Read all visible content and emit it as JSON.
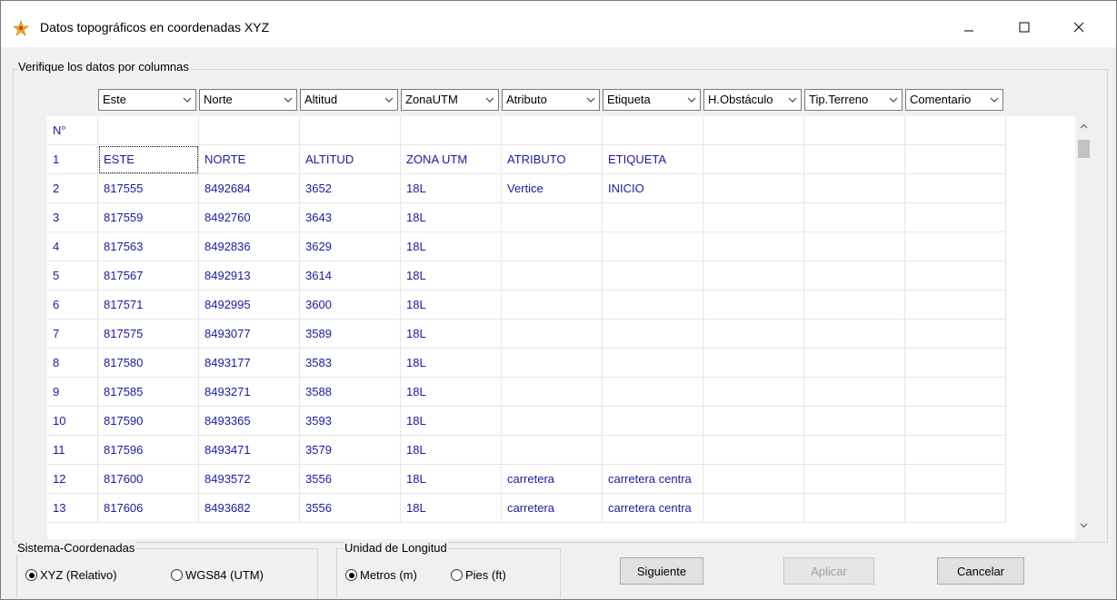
{
  "window": {
    "title": "Datos topográficos en coordenadas XYZ"
  },
  "group_main": {
    "label": "Verifique los datos por columnas"
  },
  "column_selectors": [
    "Este",
    "Norte",
    "Altitud",
    "ZonaUTM",
    "Atributo",
    "Etiqueta",
    "H.Obstáculo",
    "Tip.Terreno",
    "Comentario"
  ],
  "grid": {
    "rows": [
      [
        "N°",
        "",
        "",
        "",
        "",
        "",
        "",
        "",
        "",
        ""
      ],
      [
        "1",
        "ESTE",
        "NORTE",
        "ALTITUD",
        "ZONA UTM",
        "ATRIBUTO",
        "ETIQUETA",
        "",
        "",
        ""
      ],
      [
        "2",
        "817555",
        "8492684",
        "3652",
        "18L",
        "Vertice",
        "INICIO",
        "",
        "",
        ""
      ],
      [
        "3",
        "817559",
        "8492760",
        "3643",
        "18L",
        "",
        "",
        "",
        "",
        ""
      ],
      [
        "4",
        "817563",
        "8492836",
        "3629",
        "18L",
        "",
        "",
        "",
        "",
        ""
      ],
      [
        "5",
        "817567",
        "8492913",
        "3614",
        "18L",
        "",
        "",
        "",
        "",
        ""
      ],
      [
        "6",
        "817571",
        "8492995",
        "3600",
        "18L",
        "",
        "",
        "",
        "",
        ""
      ],
      [
        "7",
        "817575",
        "8493077",
        "3589",
        "18L",
        "",
        "",
        "",
        "",
        ""
      ],
      [
        "8",
        "817580",
        "8493177",
        "3583",
        "18L",
        "",
        "",
        "",
        "",
        ""
      ],
      [
        "9",
        "817585",
        "8493271",
        "3588",
        "18L",
        "",
        "",
        "",
        "",
        ""
      ],
      [
        "10",
        "817590",
        "8493365",
        "3593",
        "18L",
        "",
        "",
        "",
        "",
        ""
      ],
      [
        "11",
        "817596",
        "8493471",
        "3579",
        "18L",
        "",
        "",
        "",
        "",
        ""
      ],
      [
        "12",
        "817600",
        "8493572",
        "3556",
        "18L",
        "carretera",
        "carretera centra",
        "",
        "",
        ""
      ],
      [
        "13",
        "817606",
        "8493682",
        "3556",
        "18L",
        "carretera",
        "carretera centra",
        "",
        "",
        ""
      ]
    ]
  },
  "sistema": {
    "label": "Sistema-Coordenadas",
    "options": [
      "XYZ (Relativo)",
      "WGS84 (UTM)"
    ],
    "selected": "XYZ (Relativo)"
  },
  "unidad": {
    "label": "Unidad de Longitud",
    "options": [
      "Metros (m)",
      "Pies (ft)"
    ],
    "selected": "Metros (m)"
  },
  "buttons": {
    "siguiente": "Siguiente",
    "aplicar": "Aplicar",
    "cancelar": "Cancelar"
  },
  "colors": {
    "cell_text": "#1a1aa0",
    "window_bg": "#f0f0f0"
  }
}
